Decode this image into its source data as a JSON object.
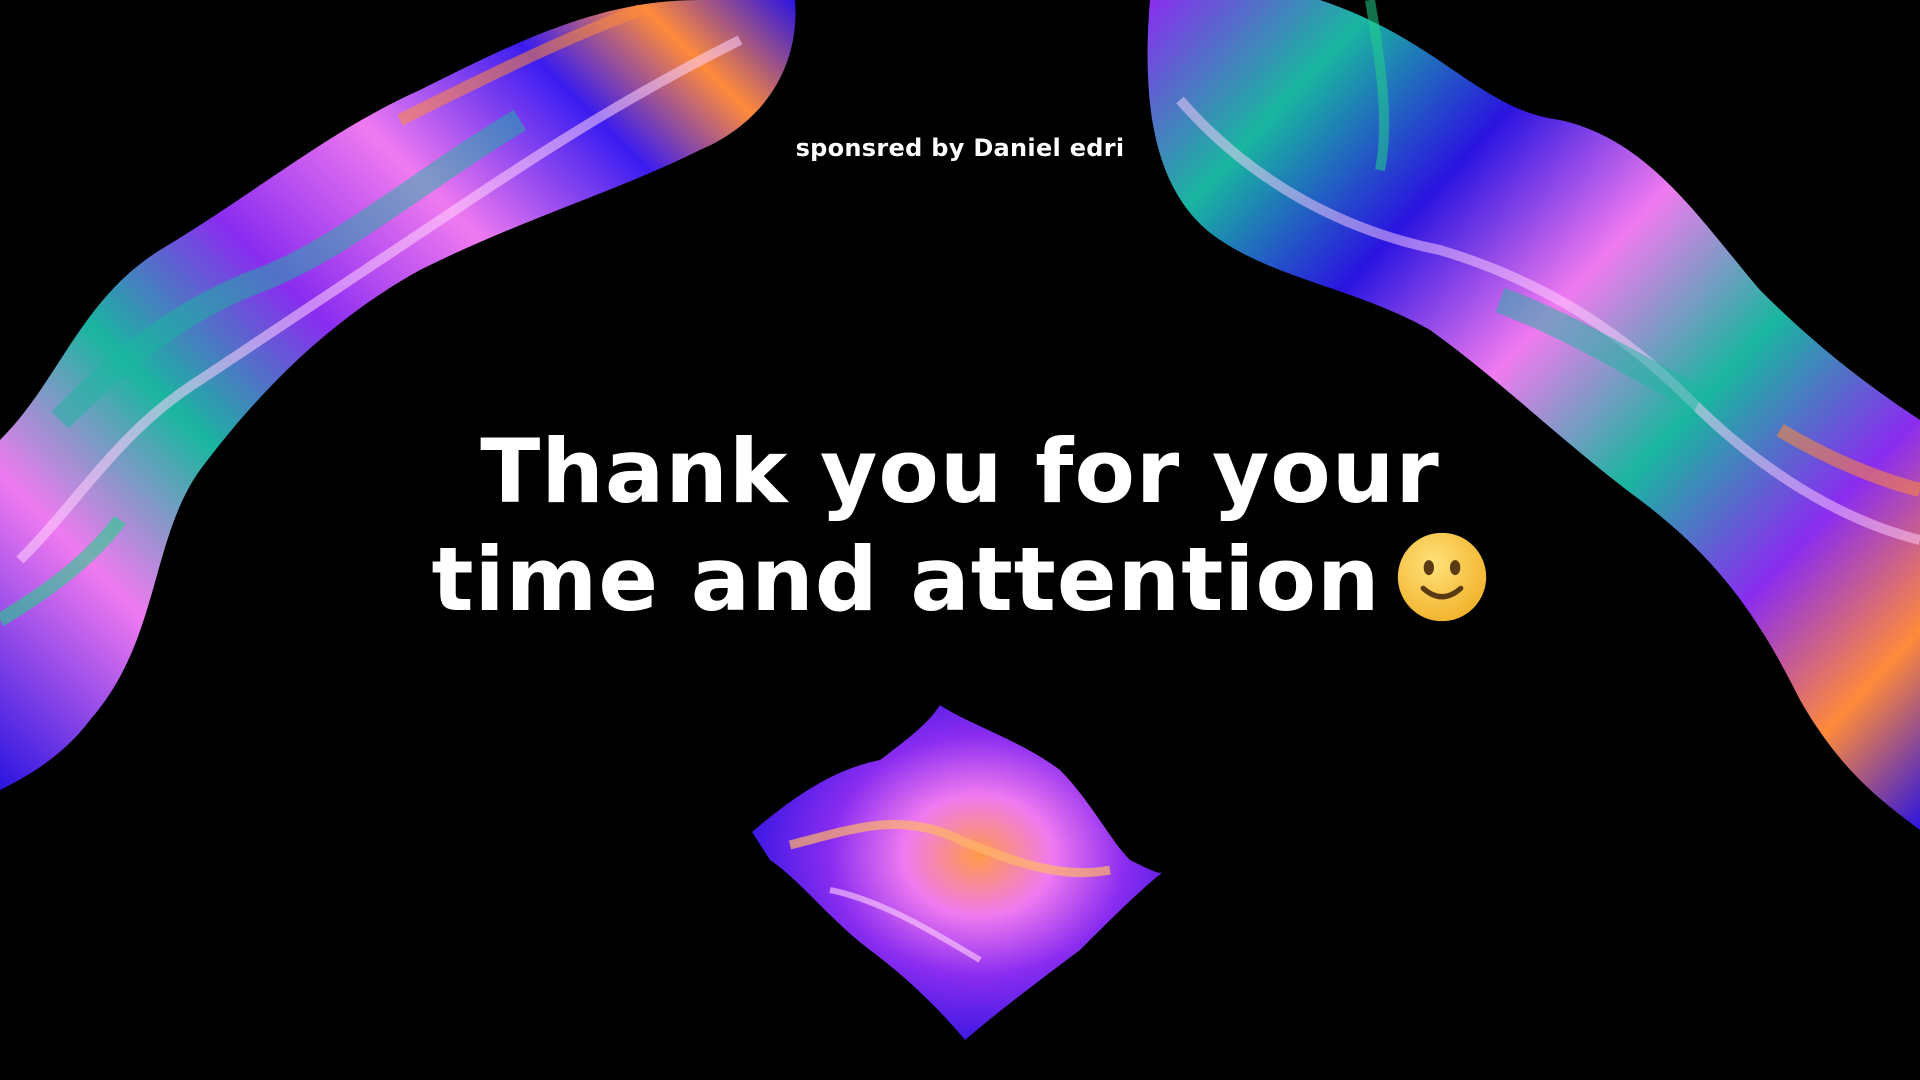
{
  "slide": {
    "sponsor_text": "sponsred by Daniel edri",
    "headline_line1": "Thank you for your",
    "headline_line2": "time and attention",
    "emoji_icon": "smiling-face-icon"
  },
  "colors": {
    "background": "#000000",
    "text": "#ffffff",
    "ribbon_blue": "#2a14e0",
    "ribbon_violet": "#8a2cf0",
    "ribbon_pink": "#f07af0",
    "ribbon_teal": "#19b6a0",
    "ribbon_orange": "#ff8a3a",
    "emoji_yellow": "#f9c640"
  }
}
